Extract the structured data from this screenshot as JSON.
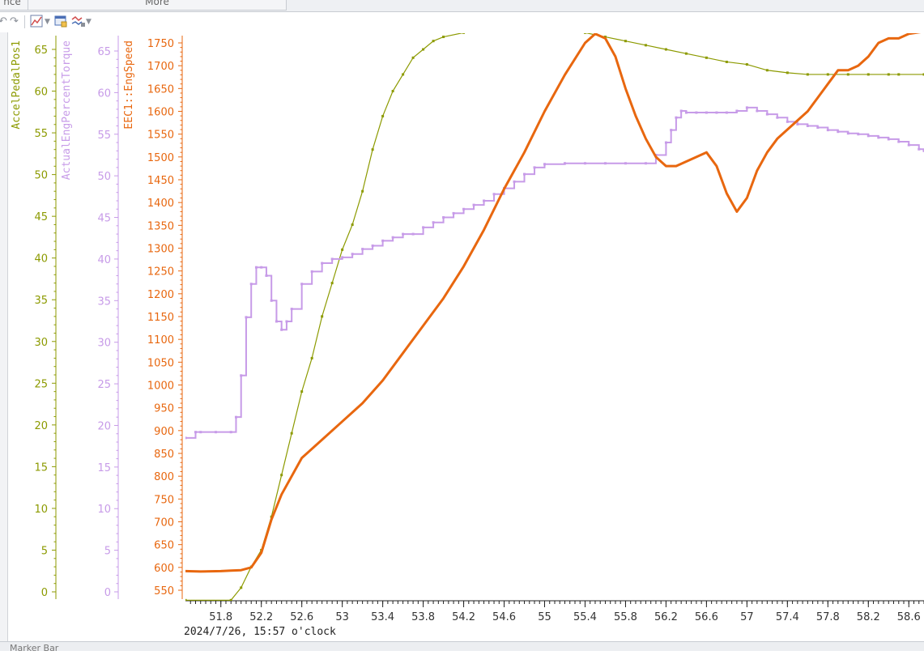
{
  "window": {
    "tab_left": "nce",
    "tab_right": "More"
  },
  "toolbar": {
    "icons": [
      "undo-icon",
      "redo-icon",
      "chart-settings-icon",
      "dropdown-icon",
      "window-icon",
      "signals-icon",
      "dropdown-icon"
    ]
  },
  "status": {
    "marker_bar": "Marker Bar"
  },
  "colors": {
    "accel": "#8c9a00",
    "torque": "#c79be8",
    "speed": "#e8670f",
    "axis_text_x": "#333333"
  },
  "chart_data": {
    "type": "line",
    "timestamp_label": "2024/7/26, 15:57 o'clock",
    "x_ticks": [
      "51.8",
      "52.2",
      "52.6",
      "53",
      "53.4",
      "53.8",
      "54.2",
      "54.6",
      "55",
      "55.4",
      "55.8",
      "56.2",
      "56.6",
      "57",
      "57.4",
      "57.8",
      "58.2",
      "58.6"
    ],
    "xlim": [
      51.45,
      58.75
    ],
    "axes": [
      {
        "id": "accel",
        "label": "AccelPedalPos1",
        "ticks": [
          0,
          5,
          10,
          15,
          20,
          25,
          30,
          35,
          40,
          45,
          50,
          55,
          60,
          65
        ],
        "ylim": [
          0,
          65
        ]
      },
      {
        "id": "torque",
        "label": "ActualEngPercentTorque",
        "ticks": [
          0,
          5,
          10,
          15,
          20,
          25,
          30,
          35,
          40,
          45,
          50,
          55,
          60,
          65
        ],
        "ylim": [
          0,
          65
        ]
      },
      {
        "id": "speed",
        "label": "EEC1::EngSpeed",
        "ticks": [
          550,
          600,
          650,
          700,
          750,
          800,
          850,
          900,
          950,
          1000,
          1050,
          1100,
          1150,
          1200,
          1250,
          1300,
          1350,
          1400,
          1450,
          1500,
          1550,
          1600,
          1650,
          1700,
          1750
        ],
        "ylim": [
          530,
          1770
        ]
      }
    ],
    "series": [
      {
        "name": "AccelPedalPos1",
        "axis": "accel",
        "style": "dotted-line",
        "x": [
          51.45,
          51.9,
          52.0,
          52.1,
          52.2,
          52.3,
          52.4,
          52.5,
          52.6,
          52.7,
          52.8,
          52.9,
          53.0,
          53.1,
          53.2,
          53.3,
          53.4,
          53.5,
          53.6,
          53.7,
          53.8,
          53.9,
          54.0,
          54.2,
          54.4,
          54.6,
          54.8,
          55.0,
          55.2,
          55.4,
          55.6,
          55.8,
          56.0,
          56.2,
          56.4,
          56.6,
          56.8,
          57.0,
          57.2,
          57.4,
          57.6,
          57.8,
          58.0,
          58.2,
          58.4,
          58.5,
          58.75
        ],
        "y": [
          -1,
          -1,
          0.5,
          3,
          5,
          9,
          14,
          19,
          24,
          28,
          33,
          37,
          41,
          44,
          48,
          53,
          57,
          60,
          62,
          64,
          65,
          66,
          66.5,
          67,
          67.5,
          67.7,
          67.8,
          67.7,
          67.5,
          67,
          66.5,
          66,
          65.5,
          65,
          64.5,
          64,
          63.5,
          63.2,
          62.5,
          62.2,
          62,
          62,
          62,
          62,
          62,
          62,
          62
        ]
      },
      {
        "name": "ActualEngPercentTorque",
        "axis": "torque",
        "style": "stepped-dots",
        "x": [
          51.45,
          51.55,
          51.6,
          51.75,
          51.9,
          51.95,
          52.0,
          52.05,
          52.1,
          52.15,
          52.2,
          52.25,
          52.3,
          52.35,
          52.4,
          52.45,
          52.5,
          52.6,
          52.7,
          52.8,
          52.9,
          53.0,
          53.1,
          53.2,
          53.3,
          53.4,
          53.5,
          53.6,
          53.7,
          53.8,
          53.9,
          54.0,
          54.1,
          54.2,
          54.3,
          54.4,
          54.5,
          54.6,
          54.7,
          54.8,
          54.9,
          55.0,
          55.2,
          55.4,
          55.6,
          55.8,
          56.0,
          56.1,
          56.2,
          56.25,
          56.3,
          56.35,
          56.4,
          56.5,
          56.6,
          56.7,
          56.8,
          56.9,
          57.0,
          57.1,
          57.2,
          57.3,
          57.4,
          57.5,
          57.6,
          57.7,
          57.8,
          57.9,
          58.0,
          58.1,
          58.2,
          58.3,
          58.4,
          58.5,
          58.6,
          58.7,
          58.75
        ],
        "y": [
          18.5,
          19.2,
          19.2,
          19.2,
          19.2,
          21,
          26,
          33,
          37,
          39,
          39,
          38,
          35,
          32.5,
          31.5,
          32.5,
          34,
          37,
          38.5,
          39.5,
          40,
          40.2,
          40.6,
          41.2,
          41.6,
          42.2,
          42.6,
          43,
          43,
          43.8,
          44.4,
          45,
          45.5,
          46,
          46.5,
          47,
          47.8,
          48.5,
          49.3,
          50.2,
          51,
          51.4,
          51.5,
          51.5,
          51.5,
          51.5,
          51.5,
          52.5,
          54,
          55.5,
          57,
          57.8,
          57.6,
          57.6,
          57.6,
          57.6,
          57.6,
          57.8,
          58.2,
          57.8,
          57.4,
          57,
          56.5,
          56.2,
          56,
          55.8,
          55.5,
          55.3,
          55.1,
          55,
          54.8,
          54.6,
          54.4,
          54.1,
          53.7,
          53.2,
          53
        ]
      },
      {
        "name": "EEC1::EngSpeed",
        "axis": "speed",
        "style": "thick-line",
        "x": [
          51.45,
          51.6,
          51.8,
          51.9,
          52.0,
          52.1,
          52.2,
          52.3,
          52.4,
          52.5,
          52.6,
          52.8,
          53.0,
          53.2,
          53.4,
          53.6,
          53.8,
          54.0,
          54.2,
          54.4,
          54.6,
          54.8,
          55.0,
          55.2,
          55.4,
          55.5,
          55.6,
          55.7,
          55.8,
          55.9,
          56.0,
          56.1,
          56.2,
          56.3,
          56.4,
          56.5,
          56.6,
          56.7,
          56.8,
          56.9,
          57.0,
          57.1,
          57.2,
          57.3,
          57.4,
          57.5,
          57.6,
          57.7,
          57.8,
          57.9,
          58.0,
          58.1,
          58.2,
          58.3,
          58.4,
          58.5,
          58.6,
          58.75
        ],
        "y": [
          592,
          591,
          592,
          593,
          594,
          600,
          632,
          705,
          760,
          800,
          840,
          880,
          920,
          960,
          1010,
          1070,
          1130,
          1190,
          1260,
          1340,
          1430,
          1510,
          1600,
          1680,
          1750,
          1770,
          1760,
          1720,
          1650,
          1590,
          1540,
          1500,
          1480,
          1480,
          1490,
          1500,
          1510,
          1480,
          1420,
          1380,
          1410,
          1470,
          1510,
          1540,
          1560,
          1580,
          1600,
          1630,
          1660,
          1690,
          1690,
          1700,
          1720,
          1750,
          1760,
          1760,
          1770,
          1775
        ]
      }
    ],
    "grid": false,
    "legend": "none (vertical axis titles on the left)"
  }
}
